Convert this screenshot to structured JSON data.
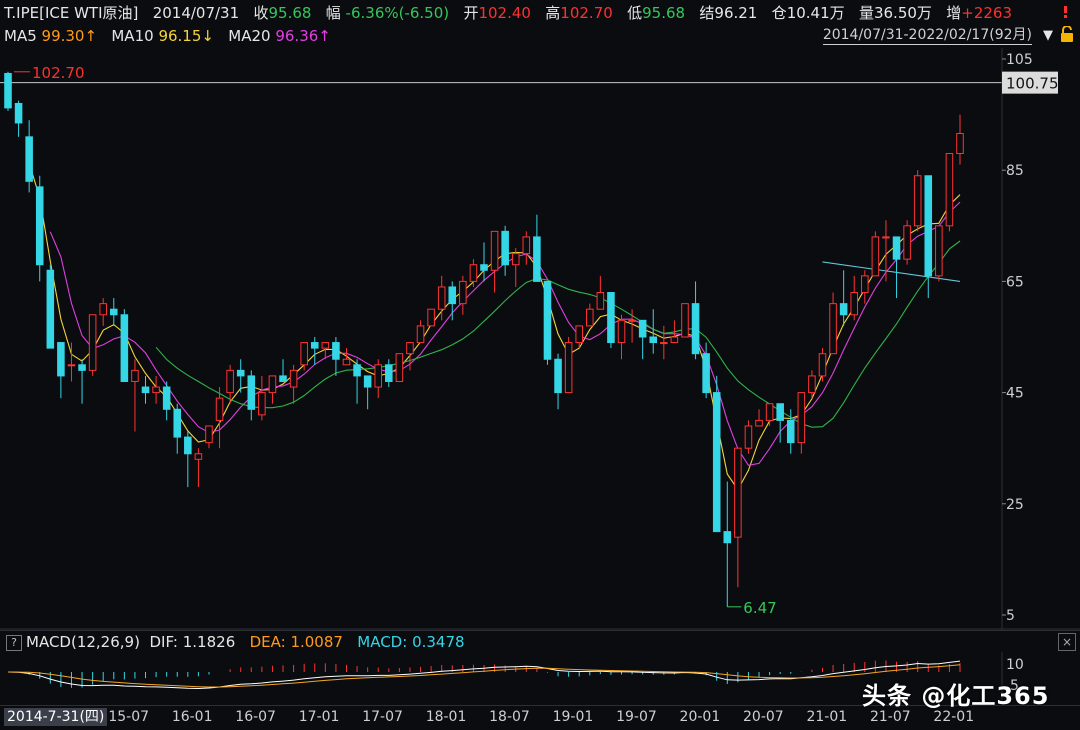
{
  "header": {
    "symbol": "T.IPE[ICE WTI原油]",
    "date": "2014/07/31",
    "close_label": "收",
    "close_value": "95.68",
    "change_label": "幅",
    "change_value": "-6.36%(-6.50)",
    "open_label": "开",
    "open_value": "102.40",
    "high_label": "高",
    "high_value": "102.70",
    "low_label": "低",
    "low_value": "95.68",
    "settle_label": "结",
    "settle_value": "96.21",
    "oi_label": "仓",
    "oi_value": "10.41万",
    "volume_label": "量",
    "volume_value": "36.50万",
    "inc_label": "增",
    "inc_value": "+2263"
  },
  "ma_legend": {
    "ma5_label": "MA5",
    "ma5_value": "99.30↑",
    "ma10_label": "MA10",
    "ma10_value": "96.15↓",
    "ma20_label": "MA20",
    "ma20_value": "96.36↑"
  },
  "range_selector": "2014/07/31-2022/02/17(92月)",
  "price_axis": {
    "ticks": [
      "105",
      "85",
      "65",
      "45",
      "25",
      "5"
    ],
    "current_price_tag": "100.75",
    "high_marker": "102.70",
    "low_marker": "6.47"
  },
  "macd": {
    "help_icon": "?",
    "label": "MACD(12,26,9)",
    "dif_label": "DIF:",
    "dif_value": "1.1826",
    "dea_label": "DEA:",
    "dea_value": "1.0087",
    "macd_label": "MACD:",
    "macd_value": "0.3478",
    "axis_top": "10",
    "axis_mid": "5",
    "close_icon": "×"
  },
  "x_axis": {
    "first": "2014-7-31(四)",
    "ticks": [
      "15-07",
      "16-01",
      "16-07",
      "17-01",
      "17-07",
      "18-01",
      "18-07",
      "19-01",
      "19-07",
      "20-01",
      "20-07",
      "21-01",
      "21-07",
      "22-01"
    ]
  },
  "watermark": "头条 @化工365",
  "colors": {
    "up": "#ff3232",
    "down": "#35d6e6",
    "ma5": "#ffffff",
    "ma10": "#f5d33a",
    "ma20": "#e040e0",
    "ma60": "#2fb34a",
    "trend": "#5fc8d8"
  },
  "chart_data": {
    "type": "candlestick",
    "ylim": [
      5,
      105
    ],
    "x": [
      "14-08",
      "14-09",
      "14-10",
      "14-11",
      "14-12",
      "15-01",
      "15-02",
      "15-03",
      "15-04",
      "15-05",
      "15-06",
      "15-07",
      "15-08",
      "15-09",
      "15-10",
      "15-11",
      "15-12",
      "16-01",
      "16-02",
      "16-03",
      "16-04",
      "16-05",
      "16-06",
      "16-07",
      "16-08",
      "16-09",
      "16-10",
      "16-11",
      "16-12",
      "17-01",
      "17-02",
      "17-03",
      "17-04",
      "17-05",
      "17-06",
      "17-07",
      "17-08",
      "17-09",
      "17-10",
      "17-11",
      "17-12",
      "18-01",
      "18-02",
      "18-03",
      "18-04",
      "18-05",
      "18-06",
      "18-07",
      "18-08",
      "18-09",
      "18-10",
      "18-11",
      "18-12",
      "19-01",
      "19-02",
      "19-03",
      "19-04",
      "19-05",
      "19-06",
      "19-07",
      "19-08",
      "19-09",
      "19-10",
      "19-11",
      "19-12",
      "20-01",
      "20-02",
      "20-03",
      "20-04",
      "20-05",
      "20-06",
      "20-07",
      "20-08",
      "20-09",
      "20-10",
      "20-11",
      "20-12",
      "21-01",
      "21-02",
      "21-03",
      "21-04",
      "21-05",
      "21-06",
      "21-07",
      "21-08",
      "21-09",
      "21-10",
      "21-11",
      "21-12",
      "22-01",
      "22-02"
    ],
    "ohlc": [
      [
        102.4,
        102.7,
        95.68,
        96.21
      ],
      [
        97,
        97.5,
        91,
        93.5
      ],
      [
        91,
        94,
        81,
        83
      ],
      [
        82,
        84,
        65,
        68
      ],
      [
        67,
        68,
        53,
        53
      ],
      [
        54,
        54,
        44,
        48
      ],
      [
        50,
        54,
        47,
        50
      ],
      [
        50,
        51,
        43,
        49
      ],
      [
        49,
        59,
        48,
        59
      ],
      [
        59,
        62,
        57,
        61
      ],
      [
        60,
        62,
        57,
        59
      ],
      [
        59,
        60,
        47,
        47
      ],
      [
        47,
        51,
        38,
        49
      ],
      [
        46,
        48,
        43,
        45
      ],
      [
        45,
        48,
        43,
        46
      ],
      [
        46,
        47,
        40,
        42
      ],
      [
        42,
        43,
        34,
        37
      ],
      [
        37,
        38,
        28,
        34
      ],
      [
        33,
        35,
        28,
        34
      ],
      [
        36,
        39,
        35,
        39
      ],
      [
        40,
        46,
        35,
        44
      ],
      [
        45,
        50,
        43,
        49
      ],
      [
        49,
        51,
        45,
        48
      ],
      [
        48,
        49,
        40,
        42
      ],
      [
        41,
        48,
        40,
        45
      ],
      [
        45,
        48,
        43,
        48
      ],
      [
        48,
        51,
        47,
        47
      ],
      [
        46,
        50,
        43,
        49
      ],
      [
        50,
        54,
        49,
        54
      ],
      [
        54,
        55,
        50,
        53
      ],
      [
        53,
        54,
        51,
        54
      ],
      [
        54,
        55,
        48,
        51
      ],
      [
        50,
        53,
        50,
        51
      ],
      [
        50,
        51,
        43,
        48
      ],
      [
        48,
        48,
        42,
        46
      ],
      [
        46,
        51,
        44,
        50
      ],
      [
        50,
        51,
        46,
        47
      ],
      [
        47,
        52,
        47,
        52
      ],
      [
        52,
        53,
        49,
        54
      ],
      [
        54,
        58,
        54,
        57
      ],
      [
        57,
        60,
        57,
        60
      ],
      [
        60,
        66,
        58,
        64
      ],
      [
        64,
        65,
        58,
        61
      ],
      [
        61,
        66,
        59,
        65
      ],
      [
        65,
        69,
        64,
        68
      ],
      [
        68,
        72,
        65,
        67
      ],
      [
        67,
        74,
        63,
        74
      ],
      [
        74,
        75,
        66,
        68
      ],
      [
        68,
        71,
        64,
        70
      ],
      [
        70,
        74,
        68,
        73
      ],
      [
        73,
        77,
        65,
        65
      ],
      [
        65,
        65,
        50,
        51
      ],
      [
        51,
        52,
        42,
        45
      ],
      [
        45,
        55,
        45,
        54
      ],
      [
        54,
        57,
        53,
        57
      ],
      [
        57,
        61,
        57,
        60
      ],
      [
        60,
        66,
        60,
        63
      ],
      [
        63,
        63,
        53,
        54
      ],
      [
        54,
        59,
        51,
        58
      ],
      [
        58,
        60,
        54,
        58
      ],
      [
        58,
        58,
        51,
        55
      ],
      [
        55,
        60,
        52,
        54
      ],
      [
        54,
        57,
        51,
        54
      ],
      [
        54,
        58,
        54,
        55
      ],
      [
        55,
        61,
        55,
        61
      ],
      [
        61,
        65,
        51,
        52
      ],
      [
        52,
        54,
        44,
        45
      ],
      [
        45,
        48,
        20,
        20
      ],
      [
        20,
        29,
        6.47,
        18
      ],
      [
        19,
        35,
        10,
        35
      ],
      [
        35,
        40,
        34,
        39
      ],
      [
        39,
        42,
        39,
        40
      ],
      [
        40,
        43,
        39,
        43
      ],
      [
        43,
        43,
        36,
        40
      ],
      [
        40,
        42,
        34,
        36
      ],
      [
        36,
        45,
        34,
        45
      ],
      [
        45,
        49,
        44,
        48
      ],
      [
        48,
        53,
        47,
        52
      ],
      [
        52,
        63,
        52,
        61
      ],
      [
        61,
        67,
        57,
        59
      ],
      [
        59,
        66,
        58,
        63
      ],
      [
        63,
        67,
        61,
        66
      ],
      [
        66,
        74,
        66,
        73
      ],
      [
        73,
        76,
        65,
        73
      ],
      [
        73,
        73,
        62,
        69
      ],
      [
        69,
        76,
        68,
        75
      ],
      [
        75,
        85,
        74,
        84
      ],
      [
        84,
        84,
        62,
        66
      ],
      [
        66,
        72,
        65,
        75
      ],
      [
        75,
        87,
        74,
        88
      ],
      [
        88,
        95,
        86,
        91.6
      ]
    ],
    "moving_averages": [
      "MA5",
      "MA10",
      "MA20"
    ],
    "macd_latest": {
      "DIF": 1.1826,
      "DEA": 1.0087,
      "MACD": 0.3478
    }
  }
}
